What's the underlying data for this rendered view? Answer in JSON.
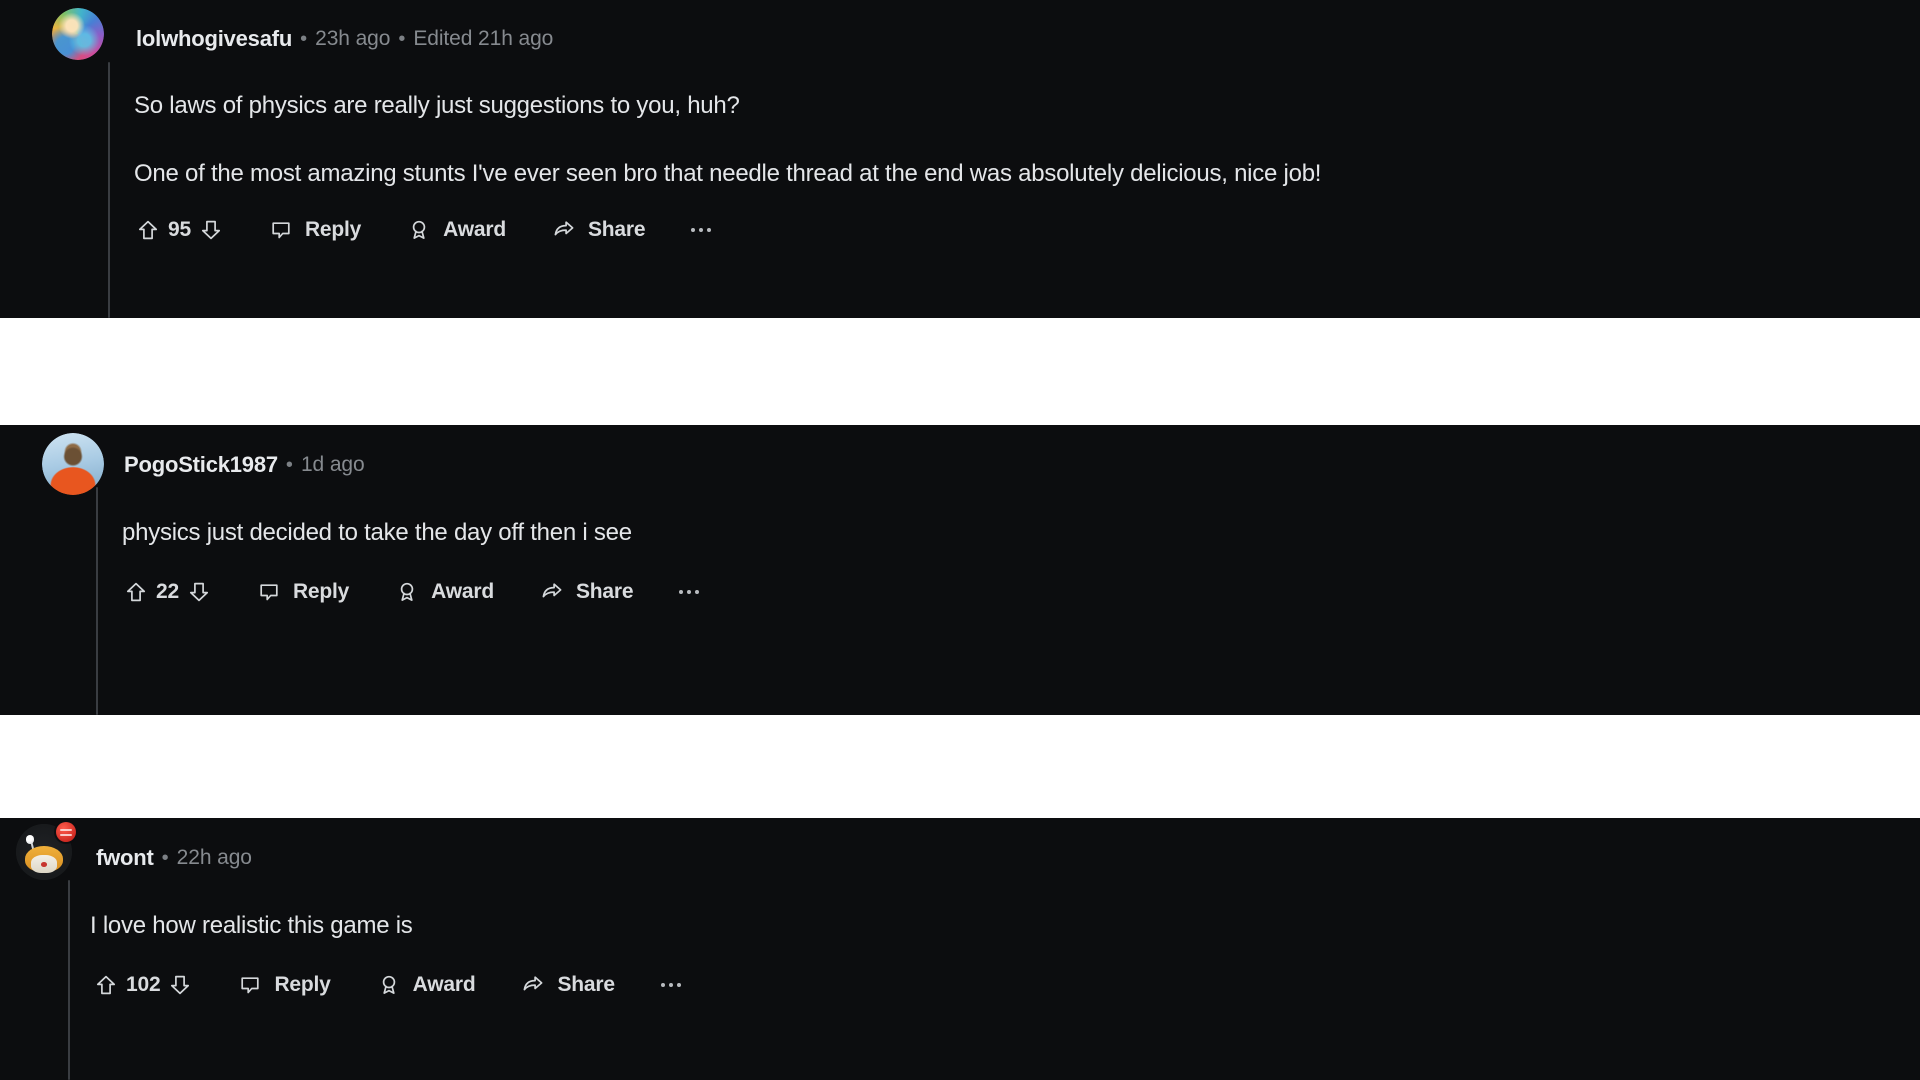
{
  "theme": {
    "card_background": "#0c0d0f",
    "page_background": "#ffffff",
    "author_color": "#e8eaed",
    "meta_color": "#868a8f",
    "body_color": "#e4e6e9",
    "action_color": "#d9dbde",
    "thread_line_color": "#3a3d42"
  },
  "actions": {
    "reply_label": "Reply",
    "award_label": "Award",
    "share_label": "Share",
    "upvote_icon": "upvote-arrow-icon",
    "downvote_icon": "downvote-arrow-icon",
    "reply_icon": "comment-bubble-icon",
    "award_icon": "award-ribbon-icon",
    "share_icon": "share-arrow-icon",
    "more_icon": "more-options-ellipsis-icon"
  },
  "comments": [
    {
      "author": "lolwhogivesafu",
      "separator": "•",
      "timestamp": "23h ago",
      "edited": "Edited 21h ago",
      "avatar_kind": "rainbow-portrait",
      "body_lines": [
        "So laws of physics are really just suggestions to you, huh?",
        "One of the most amazing stunts I've ever seen bro that needle thread at the end was absolutely delicious, nice job!"
      ],
      "vote_count": "95",
      "reply_label": "Reply",
      "award_label": "Award",
      "share_label": "Share"
    },
    {
      "author": "PogoStick1987",
      "separator": "•",
      "timestamp": "1d ago",
      "edited": "",
      "avatar_kind": "photo-portrait",
      "body_lines": [
        "physics just decided to take the day off then i see"
      ],
      "vote_count": "22",
      "reply_label": "Reply",
      "award_label": "Award",
      "share_label": "Share"
    },
    {
      "author": "fwont",
      "separator": "•",
      "timestamp": "22h ago",
      "edited": "",
      "avatar_kind": "snoo-avatar",
      "body_lines": [
        "I love how realistic this game is"
      ],
      "vote_count": "102",
      "reply_label": "Reply",
      "award_label": "Award",
      "share_label": "Share"
    }
  ]
}
